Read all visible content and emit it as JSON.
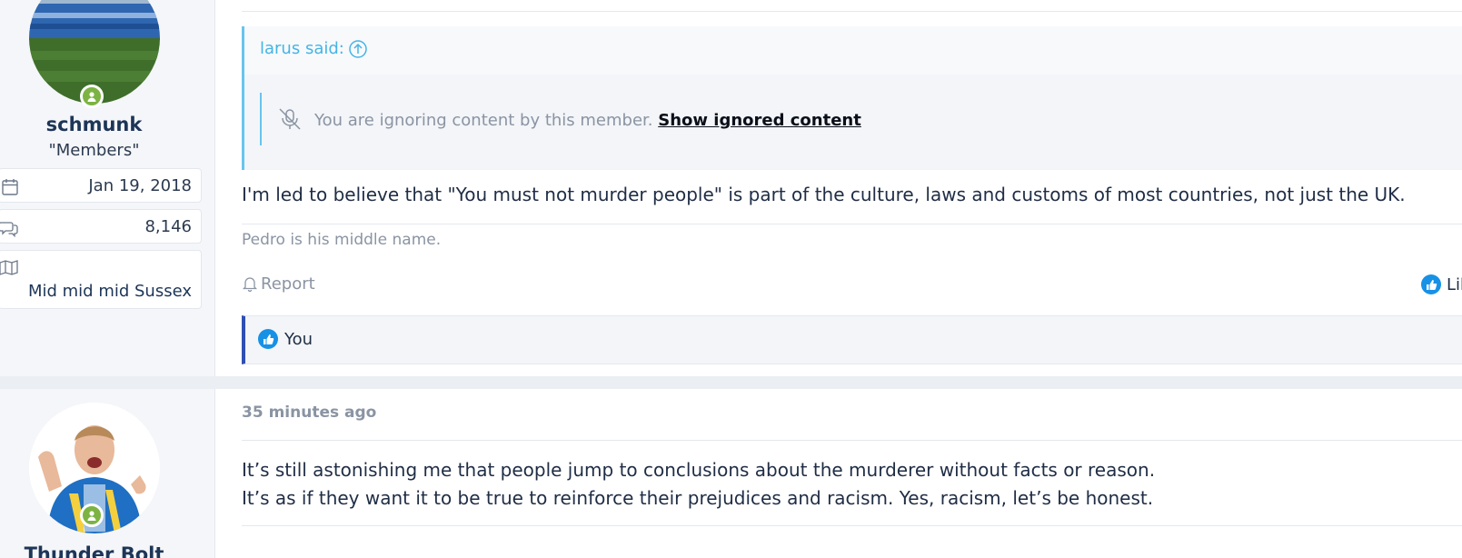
{
  "post1": {
    "user": {
      "name": "schmunk",
      "title": "\"Members\"",
      "joined": "Jan 19, 2018",
      "messages": "8,146",
      "location": "Mid mid mid Sussex"
    },
    "quote": {
      "author": "larus said:",
      "ignored_text": "You are ignoring content by this member.",
      "ignored_link": "Show ignored content"
    },
    "message": "I'm led to believe that \"You must not murder people\" is part of the culture, laws and customs of most countries, not just the UK.",
    "signature": "Pedro is his middle name.",
    "actions": {
      "report": "Report",
      "like": "Like"
    },
    "likes": "You"
  },
  "post2": {
    "user": {
      "name": "Thunder Bolt"
    },
    "timestamp": "35 minutes ago",
    "message_line1": "It’s still astonishing me that people jump to conclusions about the murderer without facts or reason.",
    "message_line2": "It’s as if they want it to be true to reinforce their prejudices and racism. Yes, racism, let’s be honest."
  },
  "colors": {
    "accent": "#45b4e6",
    "like": "#1791e6",
    "online": "#7cb342",
    "likes_border": "#2f4fb3"
  }
}
